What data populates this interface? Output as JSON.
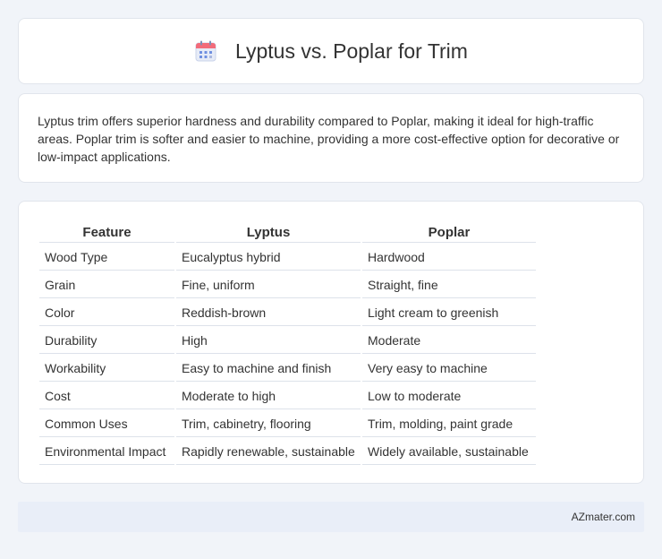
{
  "header": {
    "title": "Lyptus vs. Poplar for Trim",
    "icon": "calendar-icon"
  },
  "summary": {
    "text": "Lyptus trim offers superior hardness and durability compared to Poplar, making it ideal for high-traffic areas. Poplar trim is softer and easier to machine, providing a more cost-effective option for decorative or low-impact applications."
  },
  "table": {
    "headers": [
      "Feature",
      "Lyptus",
      "Poplar"
    ],
    "rows": [
      [
        "Wood Type",
        "Eucalyptus hybrid",
        "Hardwood"
      ],
      [
        "Grain",
        "Fine, uniform",
        "Straight, fine"
      ],
      [
        "Color",
        "Reddish-brown",
        "Light cream to greenish"
      ],
      [
        "Durability",
        "High",
        "Moderate"
      ],
      [
        "Workability",
        "Easy to machine and finish",
        "Very easy to machine"
      ],
      [
        "Cost",
        "Moderate to high",
        "Low to moderate"
      ],
      [
        "Common Uses",
        "Trim, cabinetry, flooring",
        "Trim, molding, paint grade"
      ],
      [
        "Environmental Impact",
        "Rapidly renewable, sustainable",
        "Widely available, sustainable"
      ]
    ]
  },
  "footer": {
    "brand": "AZmater.com"
  }
}
